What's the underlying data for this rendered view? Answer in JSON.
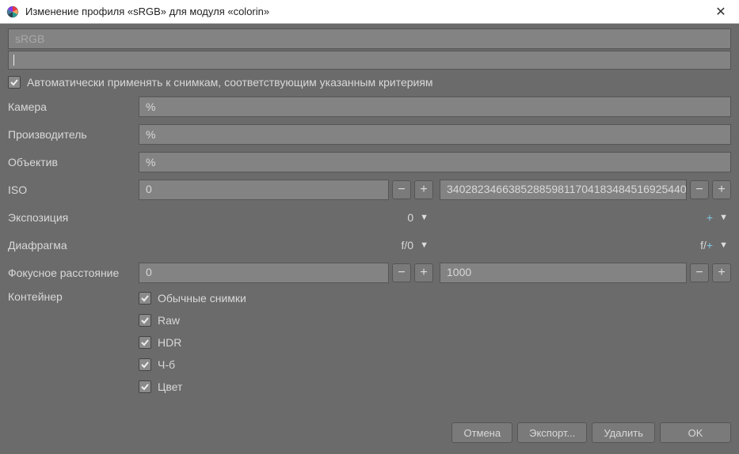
{
  "window": {
    "title": "Изменение профиля «sRGB» для модуля «colorin»"
  },
  "topField": {
    "placeholder": "sRGB",
    "searchCursor": "|"
  },
  "autoApply": {
    "checked": true,
    "label": "Автоматически применять к снимкам, соответствующим указанным критериям"
  },
  "fields": {
    "camera": {
      "label": "Камера",
      "value": "%"
    },
    "maker": {
      "label": "Производитель",
      "value": "%"
    },
    "lens": {
      "label": "Объектив",
      "value": "%"
    },
    "iso": {
      "label": "ISO",
      "min": "0",
      "max": "340282346638528859811704183484516925440"
    },
    "exposure": {
      "label": "Экспозиция",
      "min": "0",
      "max": "+"
    },
    "aperture": {
      "label": "Диафрагма",
      "min": "f/0",
      "max": "f/+"
    },
    "focal": {
      "label": "Фокусное расстояние",
      "min": "0",
      "max": "1000"
    },
    "container": {
      "label": "Контейнер"
    }
  },
  "containerOpts": [
    {
      "label": "Обычные снимки",
      "checked": true
    },
    {
      "label": "Raw",
      "checked": true
    },
    {
      "label": "HDR",
      "checked": true
    },
    {
      "label": "Ч-б",
      "checked": true
    },
    {
      "label": "Цвет",
      "checked": true
    }
  ],
  "buttons": {
    "cancel": "Отмена",
    "export": "Экспорт...",
    "delete": "Удалить",
    "ok": "OK"
  },
  "glyphs": {
    "minus": "−",
    "plus": "+",
    "caret": "▼"
  }
}
